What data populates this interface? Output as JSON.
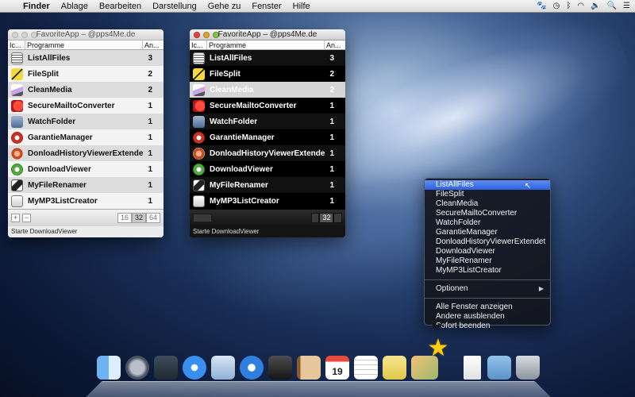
{
  "menubar": {
    "app": "Finder",
    "items": [
      "Ablage",
      "Bearbeiten",
      "Darstellung",
      "Gehe zu",
      "Fenster",
      "Hilfe"
    ],
    "status_icons": [
      "paw-icon",
      "time-machine-icon",
      "bluetooth-icon",
      "wifi-icon",
      "volume-icon",
      "spotlight-icon",
      "list-icon"
    ]
  },
  "window_light": {
    "title": "FavoriteApp – @pps4Me.de",
    "columns": [
      "Ic...",
      "Programme",
      "An..."
    ],
    "rows": [
      {
        "name": "ListAllFiles",
        "count": "3",
        "icon": "list-icon"
      },
      {
        "name": "FileSplit",
        "count": "2",
        "icon": "split-icon"
      },
      {
        "name": "CleanMedia",
        "count": "2",
        "icon": "clean-icon"
      },
      {
        "name": "SecureMailtoConverter",
        "count": "1",
        "icon": "mail-icon"
      },
      {
        "name": "WatchFolder",
        "count": "1",
        "icon": "folder-icon"
      },
      {
        "name": "GarantieManager",
        "count": "1",
        "icon": "garantie-icon"
      },
      {
        "name": "DonloadHistoryViewerExtendet",
        "count": "1",
        "icon": "history-icon"
      },
      {
        "name": "DownloadViewer",
        "count": "1",
        "icon": "download-icon"
      },
      {
        "name": "MyFileRenamer",
        "count": "1",
        "icon": "renamer-icon"
      },
      {
        "name": "MyMP3ListCreator",
        "count": "1",
        "icon": "mp3-icon"
      }
    ],
    "add": "+",
    "remove": "−",
    "sizes": [
      "16",
      "32",
      "64"
    ],
    "active_size": "32",
    "status": "Starte DownloadViewer"
  },
  "window_dark": {
    "title": "FavoriteApp – @pps4Me.de",
    "columns": [
      "Ic...",
      "Programme",
      "An..."
    ],
    "rows": [
      {
        "name": "ListAllFiles",
        "count": "3"
      },
      {
        "name": "FileSplit",
        "count": "2"
      },
      {
        "name": "CleanMedia",
        "count": "2"
      },
      {
        "name": "SecureMailtoConverter",
        "count": "1"
      },
      {
        "name": "WatchFolder",
        "count": "1"
      },
      {
        "name": "GarantieManager",
        "count": "1"
      },
      {
        "name": "DonloadHistoryViewerExtendet",
        "count": "1"
      },
      {
        "name": "DownloadViewer",
        "count": "1"
      },
      {
        "name": "MyFileRenamer",
        "count": "1"
      },
      {
        "name": "MyMP3ListCreator",
        "count": "1"
      }
    ],
    "selected_row": "CleanMedia",
    "size_label": "32",
    "status": "Starte DownloadViewer"
  },
  "dock_menu": {
    "apps": [
      "ListAllFiles",
      "FileSplit",
      "CleanMedia",
      "SecureMailtoConverter",
      "WatchFolder",
      "GarantieManager",
      "DonloadHistoryViewerExtendet",
      "DownloadViewer",
      "MyFileRenamer",
      "MyMP3ListCreator"
    ],
    "highlighted": "ListAllFiles",
    "options": "Optionen",
    "actions": [
      "Alle Fenster anzeigen",
      "Andere ausblenden",
      "Sofort beenden"
    ]
  },
  "dock": {
    "calendar_day": "19",
    "icons": [
      "finder-icon",
      "launchpad-icon",
      "mission-control-icon",
      "app-store-icon",
      "mail-icon",
      "safari-icon",
      "facetime-icon",
      "contacts-icon",
      "calendar-icon",
      "reminders-icon",
      "notes-icon",
      "favoriteapp-icon",
      "favoriteapp-star-icon",
      "document-icon",
      "downloads-folder-icon",
      "trash-icon"
    ]
  }
}
